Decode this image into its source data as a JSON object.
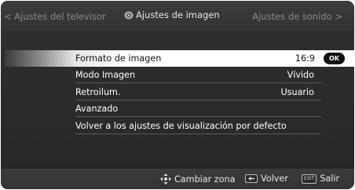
{
  "header": {
    "left_label": "< Ajustes del televisor",
    "center_label": "Ajustes de imagen",
    "right_label": "Ajustes de sonido >",
    "center_icon": "camera-icon"
  },
  "menu": {
    "items": [
      {
        "label": "Formato de imagen",
        "value": "16:9",
        "selected": true,
        "ok_label": "OK"
      },
      {
        "label": "Modo Imagen",
        "value": "Vívido"
      },
      {
        "label": "Retroilum.",
        "value": "Usuario"
      },
      {
        "label": "Avanzado",
        "value": ""
      },
      {
        "label": "Volver a los ajustes de visualización por defecto",
        "value": ""
      }
    ]
  },
  "footer": {
    "hints": [
      {
        "icon": "dpad-icon",
        "label": "Cambiar zona"
      },
      {
        "icon": "back-key-icon",
        "label": "Volver"
      },
      {
        "icon": "exit-key-icon",
        "key_text": "EXIT",
        "label": "Salir"
      }
    ]
  },
  "colors": {
    "background": "#2c2c2c",
    "selected_row": "#ffffff",
    "text": "#ffffff",
    "muted_text": "#8a8a8a"
  }
}
